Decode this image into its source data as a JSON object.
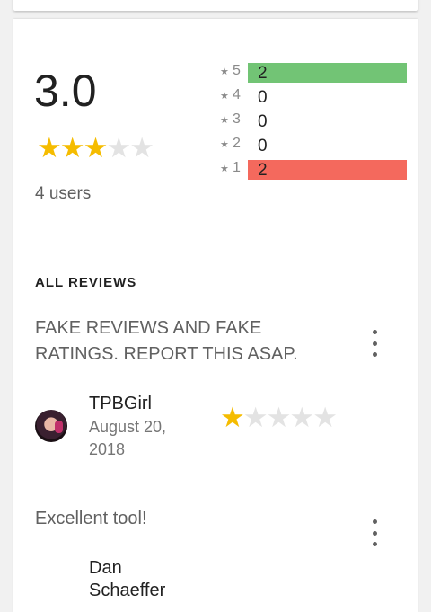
{
  "summary": {
    "average": "3.0",
    "stars_filled": 3,
    "stars_total": 5,
    "users": "4 users"
  },
  "histogram": [
    {
      "level": "5",
      "count": "2",
      "color": "#72c475",
      "fraction": 1.0
    },
    {
      "level": "4",
      "count": "0",
      "color": "#ffffff",
      "fraction": 0
    },
    {
      "level": "3",
      "count": "0",
      "color": "#ffffff",
      "fraction": 0
    },
    {
      "level": "2",
      "count": "0",
      "color": "#ffffff",
      "fraction": 0
    },
    {
      "level": "1",
      "count": "2",
      "color": "#f4695d",
      "fraction": 1.0
    }
  ],
  "reviews_section": {
    "title": "ALL REVIEWS"
  },
  "reviews": [
    {
      "text": "FAKE REVIEWS AND FAKE RATINGS. REPORT THIS ASAP.",
      "author": "TPBGirl",
      "date": "August 20, 2018",
      "rating": 1
    },
    {
      "text": "Excellent tool!",
      "author": "Dan Schaeffer"
    }
  ],
  "colors": {
    "star_filled": "#f5bc00",
    "star_empty": "#e3e3e3"
  },
  "icons": {
    "star": "★",
    "more": "more-vert-icon"
  }
}
